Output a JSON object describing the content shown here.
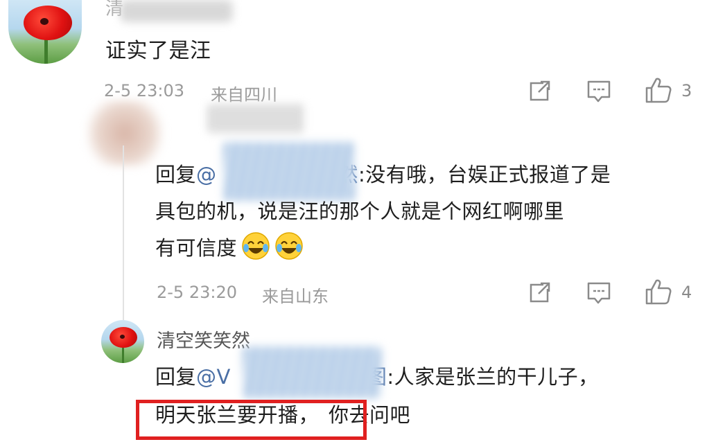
{
  "comment": {
    "username_fragment": "清",
    "text": "证实了是汪",
    "timestamp": "2-5 23:03",
    "location": "来自四川",
    "like_count": "3"
  },
  "reply1": {
    "prefix": "回复",
    "at": "@",
    "mention_tail": "然",
    "text_line1": ":没有哦，台娱正式报道了是",
    "text_line2": "具包的机，说是汪的那个人就是个网红啊哪里",
    "text_line3": "有可信度",
    "emojis": [
      "laughing-crying-emoji",
      "laughing-crying-emoji"
    ],
    "timestamp": "2-5 23:20",
    "location": "来自山东",
    "like_count": "4"
  },
  "reply2": {
    "username": "清空笑笑然",
    "prefix": "回复",
    "at": "@V",
    "mention_tail": "图",
    "text_line1": ":人家是张兰的干儿子，",
    "text_line2_highlighted": "明天张兰要开播，",
    "text_line2_rest": "你去问吧"
  },
  "icons": {
    "share": "share-icon",
    "comment": "comment-icon",
    "like": "thumbs-up-icon"
  },
  "colors": {
    "highlight_border": "#e02020",
    "meta_text": "#9a9a9a",
    "body_text": "#1e1e1e"
  }
}
